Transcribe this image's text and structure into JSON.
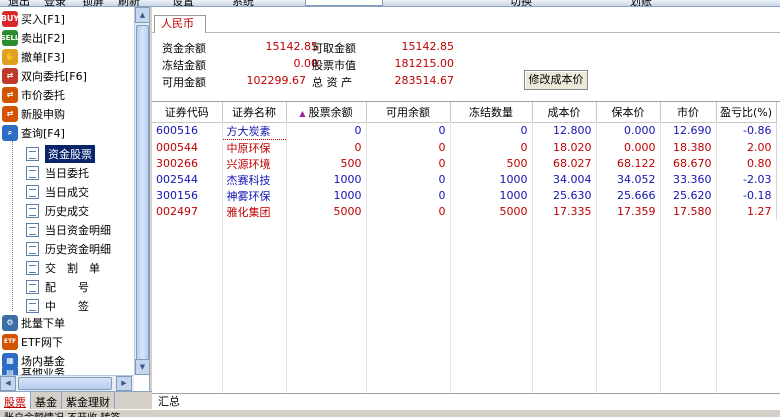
{
  "menu": [
    "退出",
    "登录",
    "锁屏",
    "刷新",
    "设置",
    "系统",
    "切换",
    "划账"
  ],
  "stock_input": "",
  "sidebar": {
    "items": [
      {
        "label": "买入[F1]",
        "icon": "buy-icon",
        "color": "#d8282a",
        "badge": "BUY"
      },
      {
        "label": "卖出[F2]",
        "icon": "sell-icon",
        "color": "#2e8b2e",
        "badge": "SELL"
      },
      {
        "label": "撤单[F3]",
        "icon": "cancel-order-icon",
        "color": "#e0a020",
        "badge": "✋"
      },
      {
        "label": "双向委托[F6]",
        "icon": "dual-order-icon",
        "color": "#c0392b",
        "badge": "⇄"
      },
      {
        "label": "市价委托",
        "icon": "market-order-icon",
        "color": "#d35400",
        "badge": "⇄"
      },
      {
        "label": "新股申购",
        "icon": "ipo-icon",
        "color": "#d35400",
        "badge": "⇄"
      },
      {
        "label": "查询[F4]",
        "icon": "query-icon",
        "color": "#2c6cc4",
        "badge": "🔍"
      }
    ],
    "sub_items": [
      "资金股票",
      "当日委托",
      "当日成交",
      "历史成交",
      "当日资金明细",
      "历史资金明细",
      "交　割　单",
      "配　　号",
      "中　　签"
    ],
    "more_items": [
      {
        "label": "批量下单",
        "icon": "batch-order-icon",
        "color": "#3a6ea5",
        "badge": "⚙"
      },
      {
        "label": "ETF网下",
        "icon": "etf-icon",
        "color": "#d35400",
        "badge": "ETF"
      },
      {
        "label": "场内基金",
        "icon": "fund-icon",
        "color": "#2c6cc4",
        "badge": "▦"
      },
      {
        "label": "其他业务",
        "icon": "other-icon",
        "color": "#2c6cc4",
        "badge": "▤"
      }
    ]
  },
  "bottom_tabs": [
    "股票",
    "基金",
    "紫金理财"
  ],
  "status_text": "账户余额情况   不开收   转签",
  "tab_label": "人民币",
  "summary": {
    "balance_label": "资金余额",
    "balance": "15142.85",
    "withdrawable_label": "可取金额",
    "withdrawable": "15142.85",
    "frozen_label": "冻结金额",
    "frozen": "0.00",
    "market_value_label": "股票市值",
    "market_value": "181215.00",
    "available_label": "可用金额",
    "available": "102299.67",
    "total_label": "总 资 产",
    "total": "283514.67",
    "modify_cost_button": "修改成本价"
  },
  "table": {
    "headers": [
      "证券代码",
      "证券名称",
      "股票余额",
      "可用余额",
      "冻结数量",
      "成本价",
      "保本价",
      "市价",
      "盈亏比(%)"
    ],
    "rows": [
      {
        "code": "600516",
        "name": "方大炭素",
        "balance": "0",
        "available": "0",
        "frozen": "0",
        "cost": "12.800",
        "breakeven": "0.000",
        "price": "12.690",
        "pl": "-0.86",
        "color": "blue"
      },
      {
        "code": "000544",
        "name": "中原环保",
        "balance": "0",
        "available": "0",
        "frozen": "0",
        "cost": "18.020",
        "breakeven": "0.000",
        "price": "18.380",
        "pl": "2.00",
        "color": "red"
      },
      {
        "code": "300266",
        "name": "兴源环境",
        "balance": "500",
        "available": "0",
        "frozen": "500",
        "cost": "68.027",
        "breakeven": "68.122",
        "price": "68.670",
        "pl": "0.80",
        "color": "red"
      },
      {
        "code": "002544",
        "name": "杰赛科技",
        "balance": "1000",
        "available": "0",
        "frozen": "1000",
        "cost": "34.004",
        "breakeven": "34.052",
        "price": "33.360",
        "pl": "-2.03",
        "color": "blue"
      },
      {
        "code": "300156",
        "name": "神雾环保",
        "balance": "1000",
        "available": "0",
        "frozen": "1000",
        "cost": "25.630",
        "breakeven": "25.666",
        "price": "25.620",
        "pl": "-0.18",
        "color": "blue"
      },
      {
        "code": "002497",
        "name": "雅化集团",
        "balance": "5000",
        "available": "0",
        "frozen": "5000",
        "cost": "17.335",
        "breakeven": "17.359",
        "price": "17.580",
        "pl": "1.27",
        "color": "red"
      }
    ],
    "total_label": "汇总"
  }
}
